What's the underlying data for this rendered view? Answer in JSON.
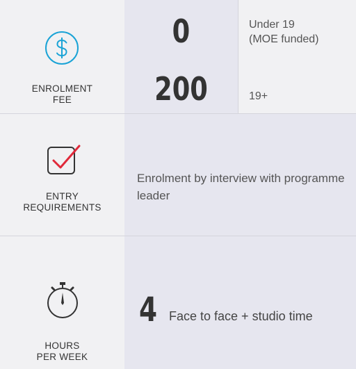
{
  "fee": {
    "label_line1": "ENROLMENT",
    "label_line2": "FEE",
    "icon": "dollar-circle-icon",
    "amount_under19": "0",
    "note_under19_line1": "Under 19",
    "note_under19_line2": "(MOE funded)",
    "amount_19plus": "200",
    "note_19plus": "19+"
  },
  "entry": {
    "label_line1": "ENTRY",
    "label_line2": "REQUIREMENTS",
    "icon": "checkbox-checked-icon",
    "text": "Enrolment by interview with programme leader"
  },
  "hours": {
    "label_line1": "HOURS",
    "label_line2": "PER WEEK",
    "icon": "stopwatch-icon",
    "value": "4",
    "text": "Face to face + studio time"
  },
  "colors": {
    "accent_blue": "#1aa3d6",
    "accent_red": "#e0293a",
    "icon_dark": "#333333"
  }
}
